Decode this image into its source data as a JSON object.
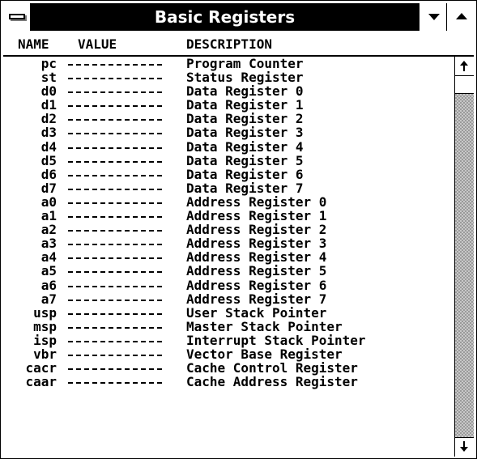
{
  "window": {
    "title": "Basic Registers"
  },
  "header": {
    "name": "NAME",
    "value": "VALUE",
    "description": "DESCRIPTION"
  },
  "registers": [
    {
      "name": "pc",
      "description": "Program Counter"
    },
    {
      "name": "st",
      "description": "Status Register"
    },
    {
      "name": "d0",
      "description": "Data Register 0"
    },
    {
      "name": "d1",
      "description": "Data Register 1"
    },
    {
      "name": "d2",
      "description": "Data Register 2"
    },
    {
      "name": "d3",
      "description": "Data Register 3"
    },
    {
      "name": "d4",
      "description": "Data Register 4"
    },
    {
      "name": "d5",
      "description": "Data Register 5"
    },
    {
      "name": "d6",
      "description": "Data Register 6"
    },
    {
      "name": "d7",
      "description": "Data Register 7"
    },
    {
      "name": "a0",
      "description": "Address Register 0"
    },
    {
      "name": "a1",
      "description": "Address Register 1"
    },
    {
      "name": "a2",
      "description": "Address Register 2"
    },
    {
      "name": "a3",
      "description": "Address Register 3"
    },
    {
      "name": "a4",
      "description": "Address Register 4"
    },
    {
      "name": "a5",
      "description": "Address Register 5"
    },
    {
      "name": "a6",
      "description": "Address Register 6"
    },
    {
      "name": "a7",
      "description": "Address Register 7"
    },
    {
      "name": "usp",
      "description": "User Stack Pointer"
    },
    {
      "name": "msp",
      "description": "Master Stack Pointer"
    },
    {
      "name": "isp",
      "description": "Interrupt Stack Pointer"
    },
    {
      "name": "vbr",
      "description": "Vector Base Register"
    },
    {
      "name": "cacr",
      "description": "Cache Control Register"
    },
    {
      "name": "caar",
      "description": "Cache Address Register"
    }
  ],
  "icons": {
    "system_menu": "system-menu-icon",
    "minimize": "minimize-arrow-icon",
    "maximize": "maximize-arrow-icon",
    "scroll_up": "scroll-up-arrow-icon",
    "scroll_down": "scroll-down-arrow-icon"
  }
}
